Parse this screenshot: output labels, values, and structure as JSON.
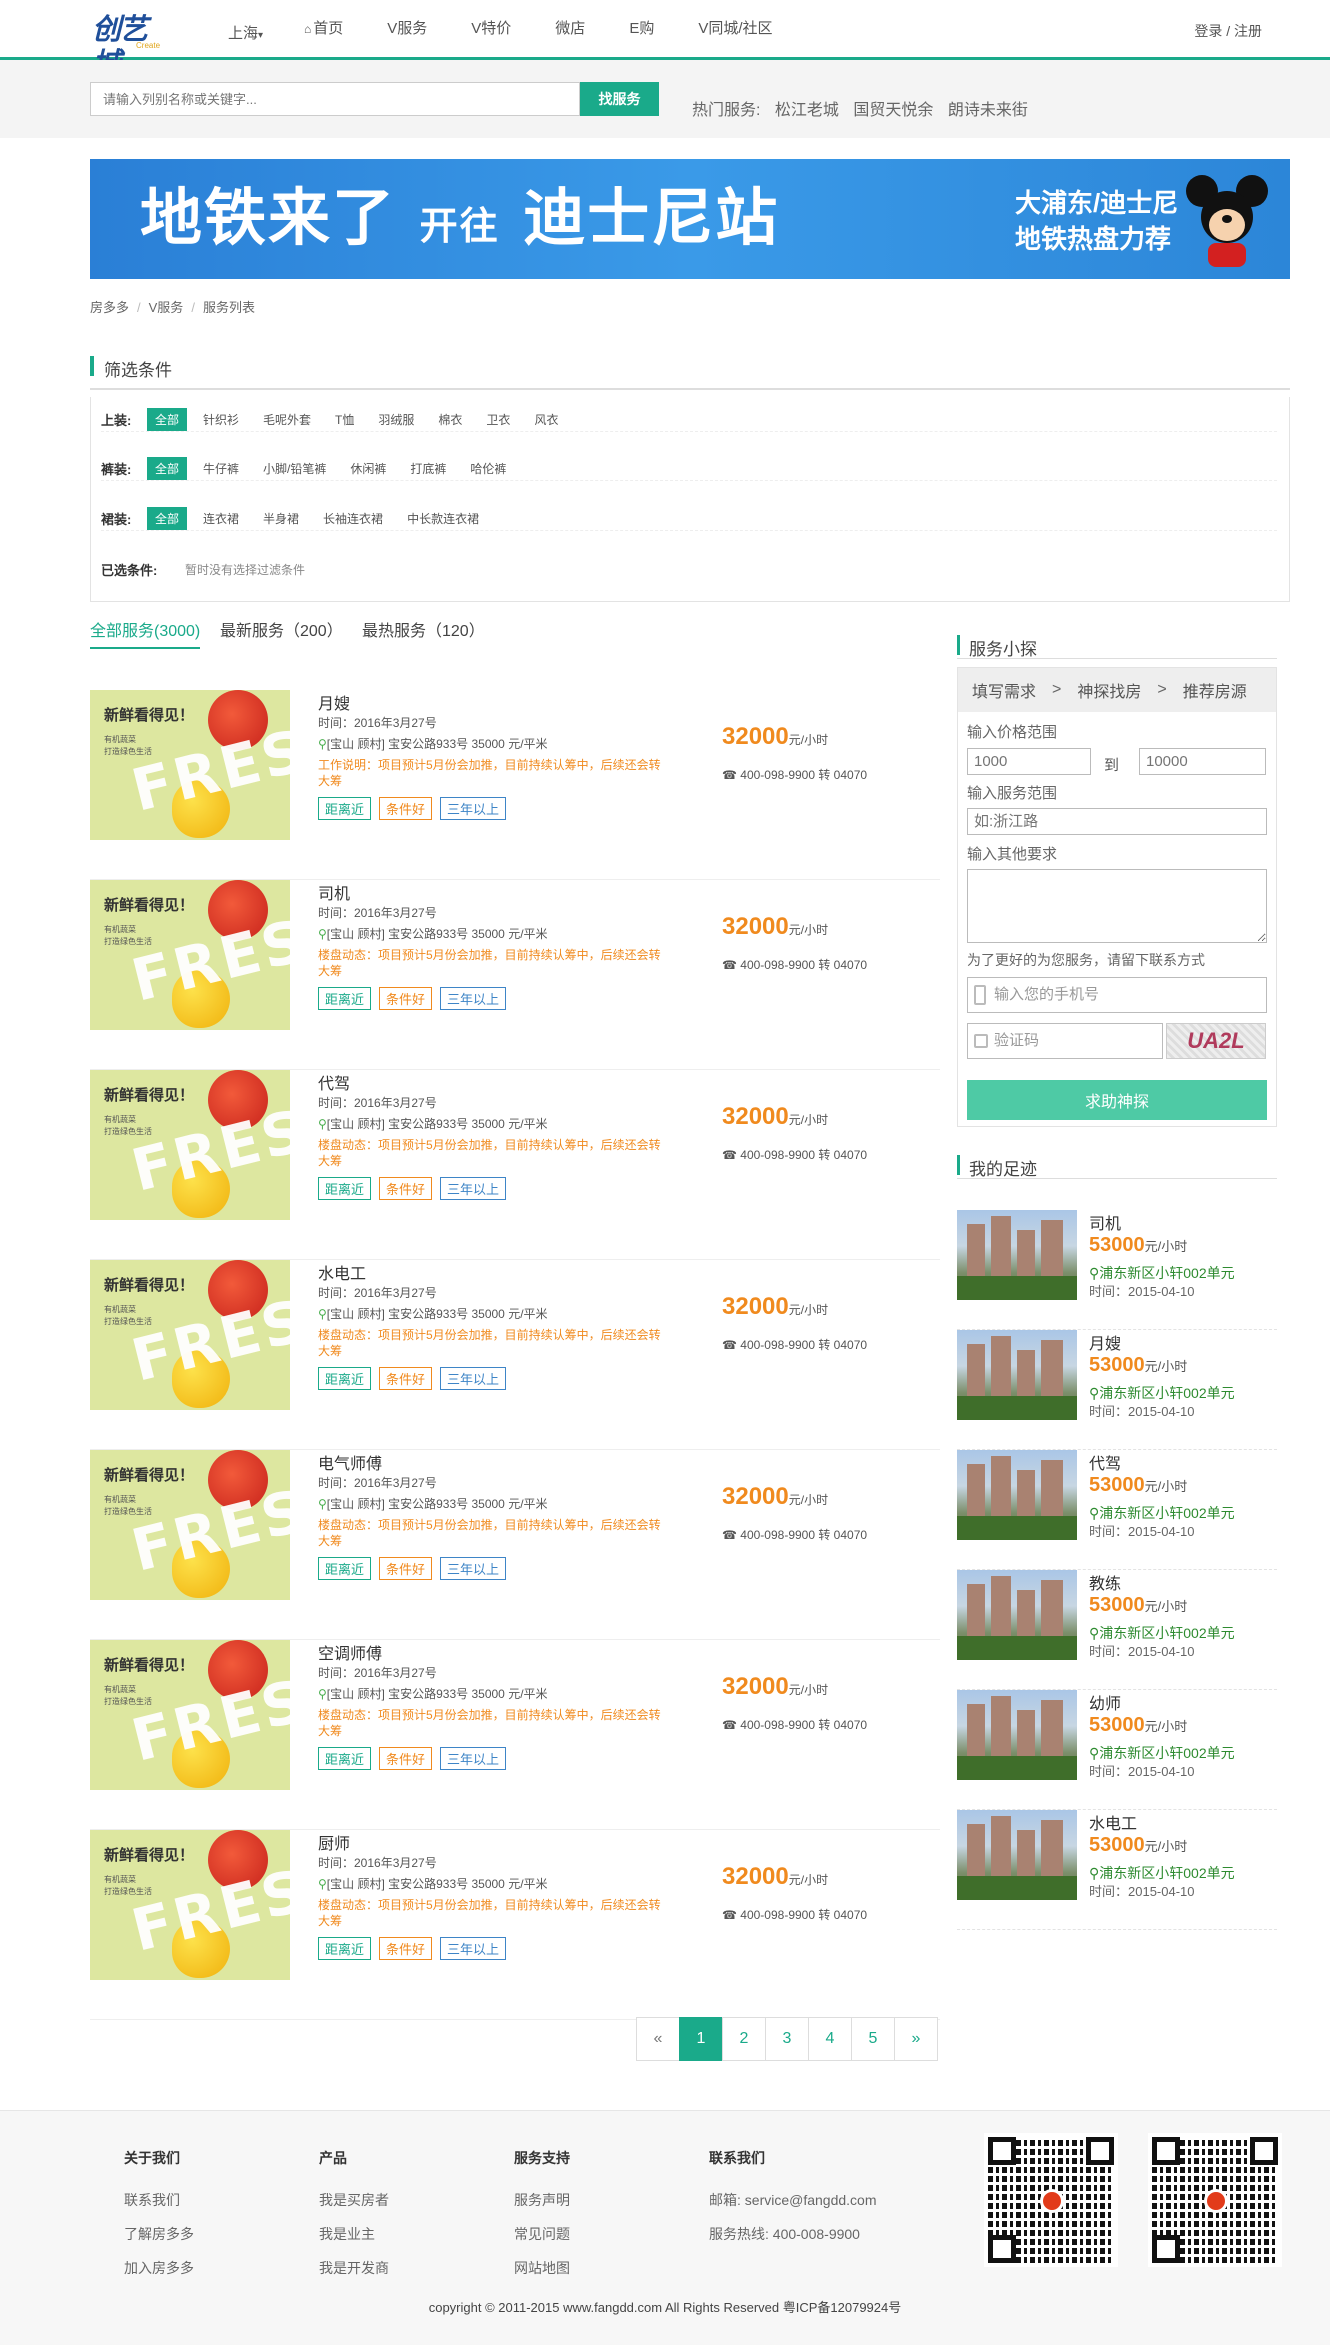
{
  "header": {
    "logo_text": "创艺城",
    "logo_sub": "Create",
    "city": "上海",
    "nav": [
      "首页",
      "V服务",
      "V特价",
      "微店",
      "E购",
      "V同城/社区"
    ],
    "login": "登录 / 注册"
  },
  "search": {
    "placeholder": "请输入列别名称或关键字...",
    "button": "找服务",
    "hot_label": "热门服务:",
    "hot_items": [
      "松江老城",
      "国贸天悦余",
      "朗诗未来街"
    ]
  },
  "banner": {
    "main_a": "地铁来了",
    "main_b": "开往",
    "main_c": "迪士尼站",
    "side_1": "大浦东/迪士尼",
    "side_2": "地铁热盘力荐"
  },
  "breadcrumb": [
    "房多多",
    "V服务",
    "服务列表"
  ],
  "filter": {
    "title": "筛选条件",
    "rows": [
      {
        "label": "上装:",
        "items": [
          "全部",
          "针织衫",
          "毛呢外套",
          "T恤",
          "羽绒服",
          "棉衣",
          "卫衣",
          "风衣"
        ]
      },
      {
        "label": "裤装:",
        "items": [
          "全部",
          "牛仔裤",
          "小脚/铅笔裤",
          "休闲裤",
          "打底裤",
          "哈伦裤"
        ]
      },
      {
        "label": "裙装:",
        "items": [
          "全部",
          "连衣裙",
          "半身裙",
          "长袖连衣裙",
          "中长款连衣裙"
        ]
      }
    ],
    "selected_label": "已选条件:",
    "selected_note": "暂时没有选择过滤条件"
  },
  "tabs": [
    "全部服务(3000)",
    "最新服务（200）",
    "最热服务（120）"
  ],
  "list_common": {
    "img_t1": "新鲜看得见！",
    "img_t2a": "有机蔬菜",
    "img_t2b": "打造绿色生活",
    "img_fresh": "FRESH",
    "time": "时间：2016年3月27号",
    "addr": "[宝山 顾村] 宝安公路933号 35000 元/平米",
    "price": "32000",
    "price_unit": "元/小时",
    "phone": "400-098-9900 转 04070",
    "tags": [
      "距离近",
      "条件好",
      "三年以上"
    ]
  },
  "list": [
    {
      "title": "月嫂",
      "desc": "工作说明：项目预计5月份会加推，目前持续认筹中，后续还会转大筹"
    },
    {
      "title": "司机",
      "desc": "楼盘动态：项目预计5月份会加推，目前持续认筹中，后续还会转大筹"
    },
    {
      "title": "代驾",
      "desc": "楼盘动态：项目预计5月份会加推，目前持续认筹中，后续还会转大筹"
    },
    {
      "title": "水电工",
      "desc": "楼盘动态：项目预计5月份会加推，目前持续认筹中，后续还会转大筹"
    },
    {
      "title": "电气师傅",
      "desc": "楼盘动态：项目预计5月份会加推，目前持续认筹中，后续还会转大筹"
    },
    {
      "title": "空调师傅",
      "desc": "楼盘动态：项目预计5月份会加推，目前持续认筹中，后续还会转大筹"
    },
    {
      "title": "厨师",
      "desc": "楼盘动态：项目预计5月份会加推，目前持续认筹中，后续还会转大筹"
    }
  ],
  "pager": [
    "«",
    "1",
    "2",
    "3",
    "4",
    "5",
    "»"
  ],
  "probe": {
    "title": "服务小探",
    "steps": [
      "填写需求",
      "神探找房",
      "推荐房源"
    ],
    "price_label": "输入价格范围",
    "price_min": "1000",
    "to": "到",
    "price_max": "10000",
    "area_label": "输入服务范围",
    "area_placeholder": "如:浙江路",
    "other_label": "输入其他要求",
    "contact_note": "为了更好的为您服务，请留下联系方式",
    "phone_placeholder": "输入您的手机号",
    "code_placeholder": "验证码",
    "captcha": "UA2L",
    "submit": "求助神探"
  },
  "footprint": {
    "title": "我的足迹",
    "price_unit": "元/小时",
    "addr": "浦东新区小轩002单元",
    "time": "时间：2015-04-10",
    "price": "53000",
    "items": [
      "司机",
      "月嫂",
      "代驾",
      "教练",
      "幼师",
      "水电工"
    ]
  },
  "footer": {
    "cols": [
      {
        "h": "关于我们",
        "l": [
          "联系我们",
          "了解房多多",
          "加入房多多"
        ]
      },
      {
        "h": "产品",
        "l": [
          "我是买房者",
          "我是业主",
          "我是开发商"
        ]
      },
      {
        "h": "服务支持",
        "l": [
          "服务声明",
          "常见问题",
          "网站地图"
        ]
      },
      {
        "h": "联系我们",
        "l": [
          "邮箱: service@fangdd.com",
          "服务热线: 400-008-9900"
        ]
      }
    ],
    "copyright": "copyright © 2011-2015 www.fangdd.com All Rights Reserved 粤ICP备12079924号"
  },
  "colors": {
    "accent": "#1aaa8a",
    "orange": "#f08a1e",
    "green_text": "#2e8b30"
  }
}
